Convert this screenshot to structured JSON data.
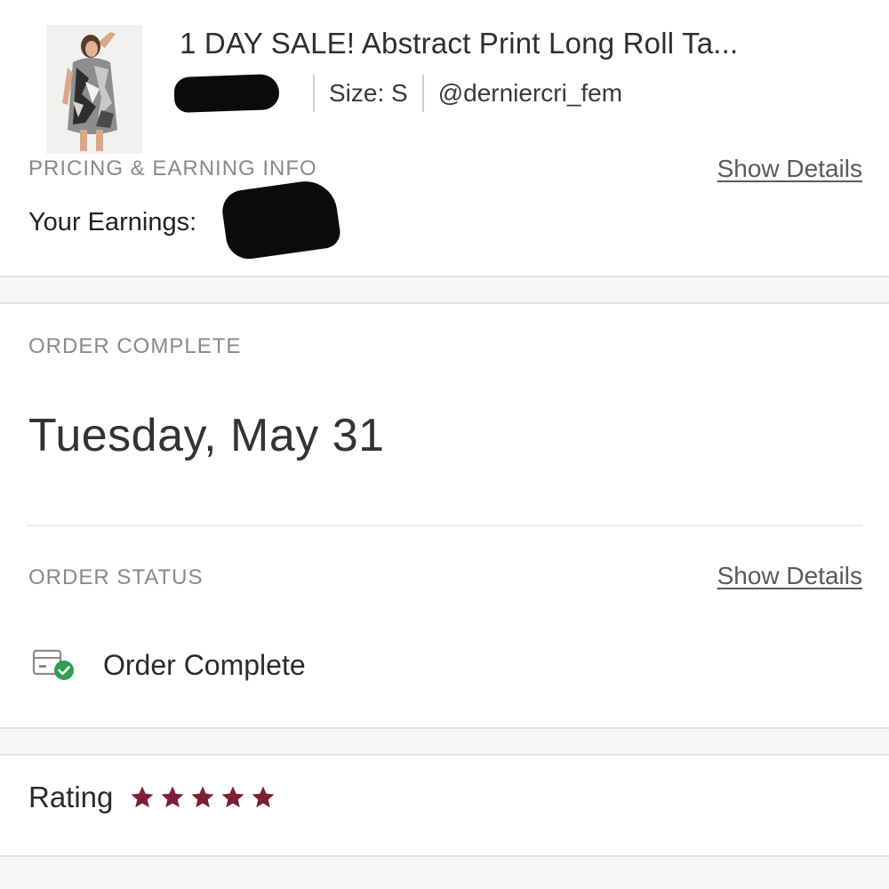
{
  "listing": {
    "title": "1 DAY SALE! Abstract Print Long Roll Ta...",
    "size": "Size: S",
    "seller": "@derniercri_fem",
    "thumbnail_icon": "dress-photo"
  },
  "pricing": {
    "section_label": "PRICING & EARNING INFO",
    "show_details": "Show Details",
    "earnings_label": "Your Earnings:"
  },
  "order_complete": {
    "section_label": "ORDER COMPLETE",
    "date": "Tuesday, May 31"
  },
  "order_status": {
    "section_label": "ORDER STATUS",
    "show_details": "Show Details",
    "status_text": "Order Complete",
    "status_icon": "package-check-icon",
    "check_color": "#2e9e4f"
  },
  "rating": {
    "label": "Rating",
    "stars": 5,
    "max_stars": 5,
    "star_color": "#7d1f33"
  }
}
